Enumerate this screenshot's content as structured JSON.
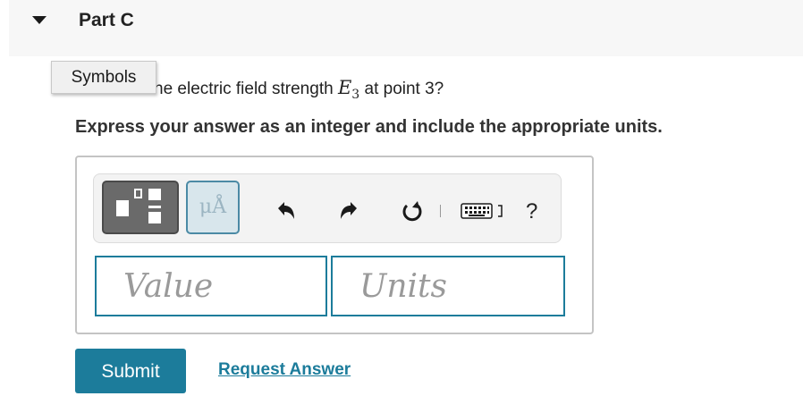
{
  "part": {
    "title": "Part C"
  },
  "tooltip": {
    "label": "Symbols"
  },
  "question": {
    "prefix": "he electric field strength ",
    "symbol": "E",
    "subscript": "3",
    "suffix": " at point 3?"
  },
  "instruction": "Express your answer as an integer and include the appropriate units.",
  "toolbar": {
    "units_label": "μÅ",
    "help_label": "?",
    "icons": [
      "templates-icon",
      "units-icon",
      "undo-icon",
      "redo-icon",
      "reset-icon",
      "keyboard-icon",
      "help-icon"
    ]
  },
  "inputs": {
    "value_placeholder": "Value",
    "units_placeholder": "Units"
  },
  "actions": {
    "submit_label": "Submit",
    "request_label": "Request Answer"
  },
  "colors": {
    "accent": "#1c7c9b",
    "header_bg": "#f7f7f7"
  }
}
